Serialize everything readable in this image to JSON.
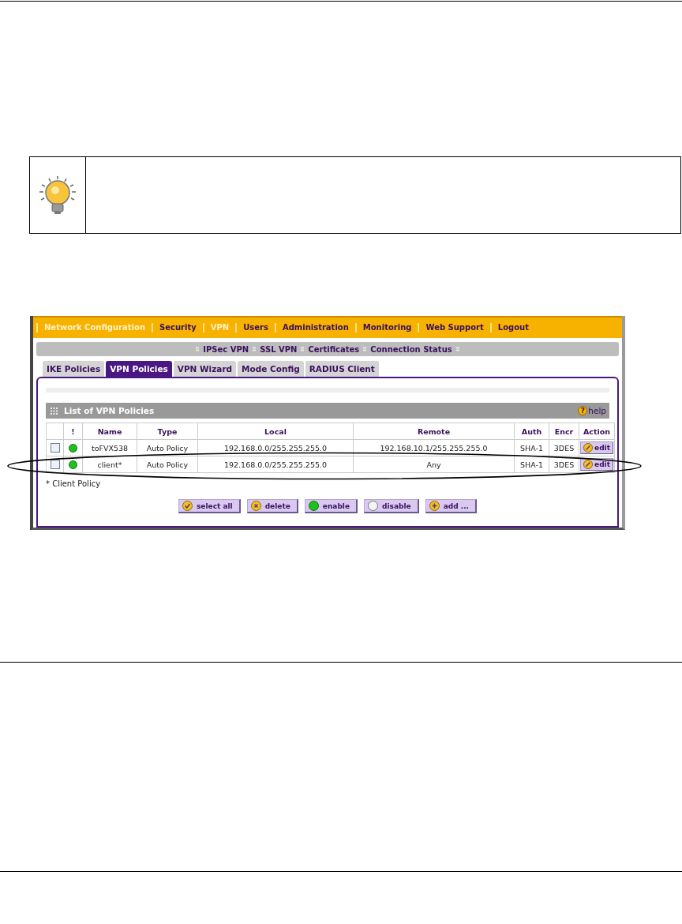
{
  "nav": [
    {
      "label": "Network Configuration",
      "selected": true
    },
    {
      "label": "Security",
      "selected": false
    },
    {
      "label": "VPN",
      "selected": true
    },
    {
      "label": "Users",
      "selected": false
    },
    {
      "label": "Administration",
      "selected": false
    },
    {
      "label": "Monitoring",
      "selected": false
    },
    {
      "label": "Web Support",
      "selected": false
    },
    {
      "label": "Logout",
      "selected": false
    }
  ],
  "subnav": [
    {
      "label": "IPSec VPN"
    },
    {
      "label": "SSL VPN"
    },
    {
      "label": "Certificates"
    },
    {
      "label": "Connection Status"
    }
  ],
  "tabs": [
    {
      "label": "IKE Policies",
      "selected": false
    },
    {
      "label": "VPN Policies",
      "selected": true
    },
    {
      "label": "VPN Wizard",
      "selected": false
    },
    {
      "label": "Mode Config",
      "selected": false
    },
    {
      "label": "RADIUS Client",
      "selected": false
    }
  ],
  "panel": {
    "title": "List of VPN Policies",
    "help_icon": "?",
    "help": "help"
  },
  "table": {
    "columns": [
      "!",
      "Name",
      "Type",
      "Local",
      "Remote",
      "Auth",
      "Encr",
      "Action"
    ],
    "rows": [
      {
        "checked": false,
        "enabled": true,
        "name": "toFVX538",
        "type": "Auto Policy",
        "local": "192.168.0.0/255.255.255.0",
        "remote": "192.168.10.1/255.255.255.0",
        "auth": "SHA-1",
        "encr": "3DES",
        "action": "edit",
        "highlighted": false
      },
      {
        "checked": false,
        "enabled": true,
        "name": "client*",
        "type": "Auto Policy",
        "local": "192.168.0.0/255.255.255.0",
        "remote": "Any",
        "auth": "SHA-1",
        "encr": "3DES",
        "action": "edit",
        "highlighted": true
      }
    ]
  },
  "footnote": "* Client Policy",
  "buttons": [
    {
      "kind": "select",
      "label": "select all"
    },
    {
      "kind": "delete",
      "label": "delete"
    },
    {
      "kind": "enable",
      "label": "enable"
    },
    {
      "kind": "disable",
      "label": "disable"
    },
    {
      "kind": "add",
      "label": "add ..."
    }
  ]
}
